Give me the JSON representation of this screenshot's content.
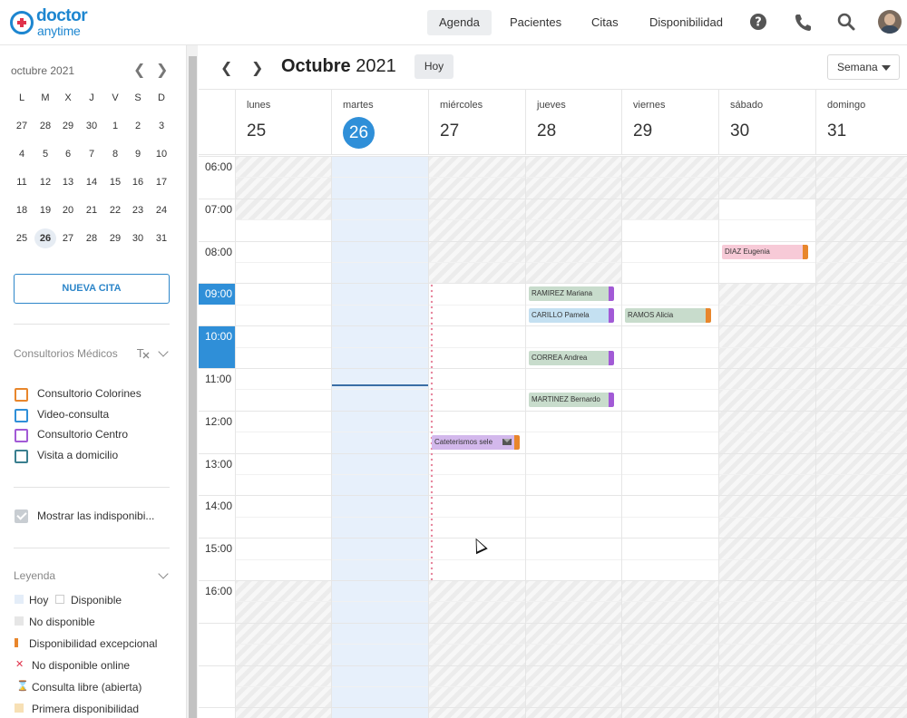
{
  "topbar": {
    "logo_line1": "doctor",
    "logo_line2": "anytime",
    "nav": [
      "Agenda",
      "Pacientes",
      "Citas",
      "Disponibilidad"
    ]
  },
  "sidebar": {
    "minical": {
      "title": "octubre 2021",
      "weekdays": [
        "L",
        "M",
        "X",
        "J",
        "V",
        "S",
        "D"
      ],
      "weeks": [
        [
          "27",
          "28",
          "29",
          "30",
          "1",
          "2",
          "3"
        ],
        [
          "4",
          "5",
          "6",
          "7",
          "8",
          "9",
          "10"
        ],
        [
          "11",
          "12",
          "13",
          "14",
          "15",
          "16",
          "17"
        ],
        [
          "18",
          "19",
          "20",
          "21",
          "22",
          "23",
          "24"
        ],
        [
          "25",
          "26",
          "27",
          "28",
          "29",
          "30",
          "31"
        ]
      ],
      "today": "26"
    },
    "new_button": "NUEVA CITA",
    "consultorios": {
      "title": "Consultorios Médicos",
      "items": [
        {
          "label": "Consultorio Colorines",
          "color": "#e8862c"
        },
        {
          "label": "Video-consulta",
          "color": "#2f8fd8"
        },
        {
          "label": "Consultorio Centro",
          "color": "#a25ad6"
        },
        {
          "label": "Visita a domicilio",
          "color": "#3a7f8f"
        }
      ]
    },
    "show_unavailable": "Mostrar las indisponibi...",
    "leyenda": {
      "title": "Leyenda",
      "hoy": "Hoy",
      "disponible": "Disponible",
      "no_disponible": "No disponible",
      "excepcional": "Disponibilidad excepcional",
      "no_online": "No disponible online",
      "consulta_libre": "Consulta libre (abierta)",
      "primera": "Primera disponibilidad"
    }
  },
  "calendar": {
    "title_month": "Octubre",
    "title_year": "2021",
    "today_button": "Hoy",
    "view_select": "Semana",
    "days": [
      {
        "name": "lunes",
        "num": "25"
      },
      {
        "name": "martes",
        "num": "26"
      },
      {
        "name": "miércoles",
        "num": "27"
      },
      {
        "name": "jueves",
        "num": "28"
      },
      {
        "name": "viernes",
        "num": "29"
      },
      {
        "name": "sábado",
        "num": "30"
      },
      {
        "name": "domingo",
        "num": "31"
      }
    ],
    "today_index": 1,
    "hours": [
      "06:00",
      "07:00",
      "08:00",
      "09:00",
      "10:00",
      "11:00",
      "12:00",
      "13:00",
      "14:00",
      "15:00",
      "16:00"
    ],
    "events": [
      {
        "label": "DIAZ Eugenia",
        "day": "sábado",
        "start": "08:00"
      },
      {
        "label": "RAMIREZ Mariana",
        "day": "jueves",
        "start": "09:00"
      },
      {
        "label": "CARILLO Pamela",
        "day": "jueves",
        "start": "09:30"
      },
      {
        "label": "RAMOS Alicia",
        "day": "viernes",
        "start": "09:30"
      },
      {
        "label": "CORREA Andrea",
        "day": "jueves",
        "start": "10:30"
      },
      {
        "label": "MARTINEZ Bernardo",
        "day": "jueves",
        "start": "11:30"
      },
      {
        "label": "Cateterismos sele",
        "day": "miércoles",
        "start": "12:30"
      }
    ],
    "colors": {
      "accent": "#2f8fd8",
      "orange": "#e8862c",
      "purple": "#a25ad6"
    }
  }
}
